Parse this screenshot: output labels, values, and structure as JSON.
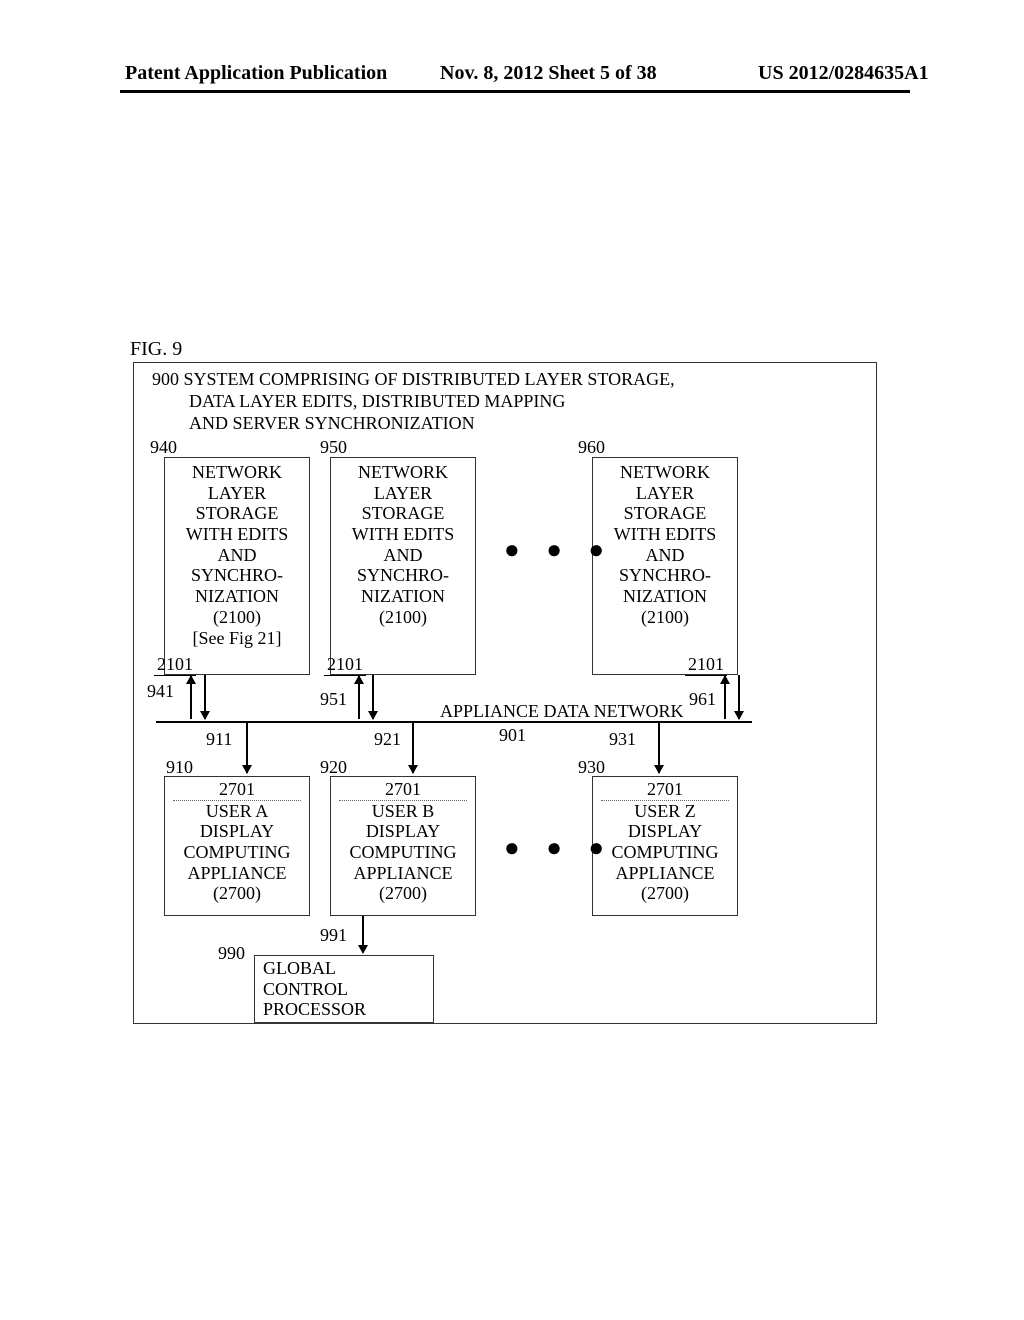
{
  "header": {
    "left": "Patent Application Publication",
    "mid": "Nov. 8, 2012   Sheet 5 of 38",
    "right": "US 2012/0284635A1"
  },
  "figLabel": "FIG. 9",
  "title": {
    "l1": "900 SYSTEM COMPRISING OF DISTRIBUTED LAYER STORAGE,",
    "l2": "DATA LAYER EDITS, DISTRIBUTED MAPPING",
    "l3": "AND SERVER SYNCHRONIZATION"
  },
  "storage": {
    "l1": "NETWORK",
    "l2": "LAYER",
    "l3": "STORAGE",
    "l4": "WITH EDITS",
    "l5": "AND",
    "l6": "SYNCHRO-",
    "l7": "NIZATION",
    "l8": "(2100)",
    "see": "[See Fig 21]"
  },
  "labels": {
    "n940": "940",
    "n950": "950",
    "n960": "960",
    "n2101a": "2101",
    "n2101b": "2101",
    "n2101c": "2101",
    "n941": "941",
    "n951": "951",
    "n961": "961",
    "appnet": "APPLIANCE DATA NETWORK",
    "n901": "901",
    "n911": "911",
    "n921": "921",
    "n931": "931",
    "n910": "910",
    "n920": "920",
    "n930": "930",
    "n2701a": "2701",
    "n2701b": "2701",
    "n2701c": "2701",
    "n991": "991",
    "n990": "990"
  },
  "user": {
    "a1": "USER A",
    "b1": "USER B",
    "z1": "USER Z",
    "l2": "DISPLAY",
    "l3": "COMPUTING",
    "l4": "APPLIANCE",
    "l5": "(2700)"
  },
  "global": {
    "l1": "GLOBAL",
    "l2": "CONTROL",
    "l3": "PROCESSOR"
  },
  "dots": "●  ●  ●"
}
